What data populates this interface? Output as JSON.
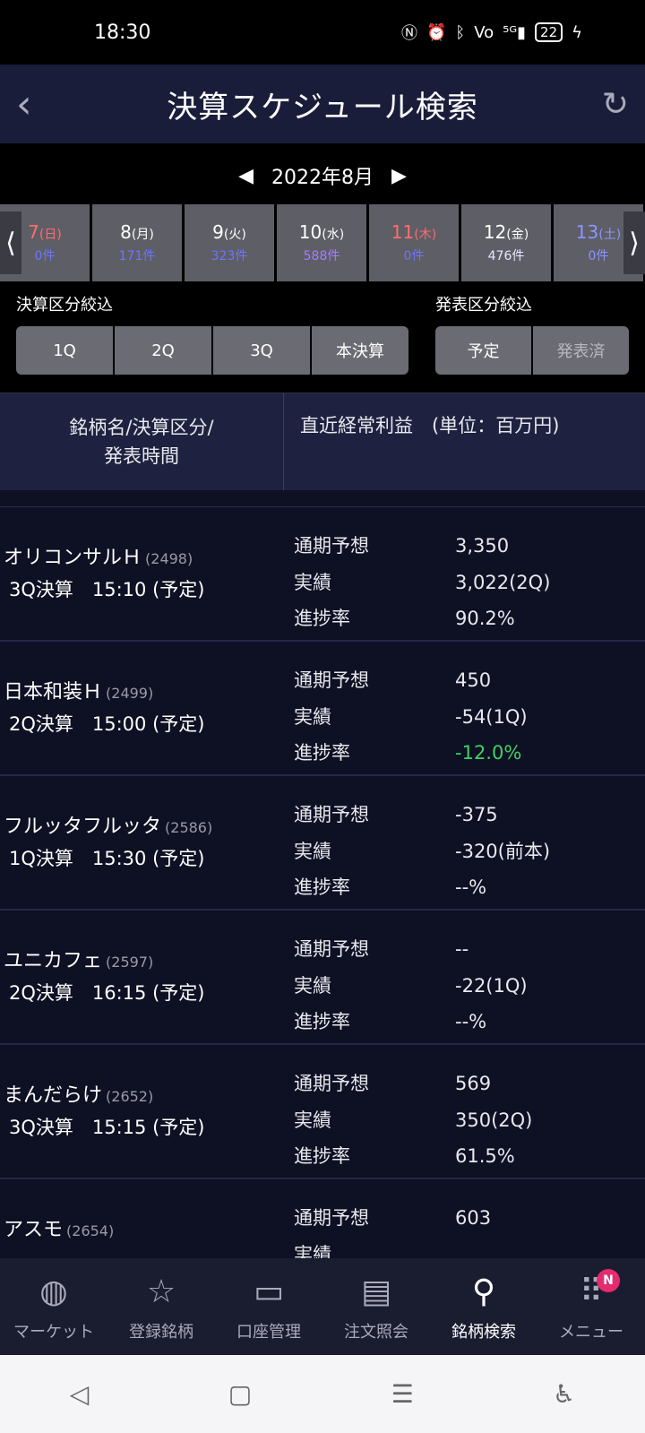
{
  "status": {
    "time": "18:30",
    "icons": [
      "nfc-icon",
      "alarm-icon",
      "bluetooth-icon",
      "volte-icon",
      "signal-5g-icon"
    ],
    "battery": "22"
  },
  "header": {
    "title": "決算スケジュール検索"
  },
  "month": {
    "label": "2022年8月"
  },
  "days": [
    {
      "date": "7",
      "dow": "(日)",
      "count": "0件",
      "type": "sun"
    },
    {
      "date": "8",
      "dow": "(月)",
      "count": "171件",
      "type": "weekday"
    },
    {
      "date": "9",
      "dow": "(火)",
      "count": "323件",
      "type": "weekday"
    },
    {
      "date": "10",
      "dow": "(水)",
      "count": "588件",
      "type": "weekday"
    },
    {
      "date": "11",
      "dow": "(木)",
      "count": "0件",
      "type": "holiday"
    },
    {
      "date": "12",
      "dow": "(金)",
      "count": "476件",
      "type": "selected"
    },
    {
      "date": "13",
      "dow": "(土)",
      "count": "0件",
      "type": "sat"
    }
  ],
  "filters": {
    "settlement_label": "決算区分絞込",
    "settlement_options": [
      "1Q",
      "2Q",
      "3Q",
      "本決算"
    ],
    "announce_label": "発表区分絞込",
    "announce_options": [
      "予定",
      "発表済"
    ]
  },
  "table_header": {
    "col1_line1": "銘柄名/決算区分/",
    "col1_line2": "発表時間",
    "col2": "直近経常利益　(単位：百万円)"
  },
  "row_labels": {
    "forecast": "通期予想",
    "actual": "実績",
    "progress": "進捗率"
  },
  "rows": [
    {
      "name": "オリコンサルＨ",
      "code": "(2498)",
      "sub": "3Q決算　15:10 (予定)",
      "forecast": "3,350",
      "actual": "3,022(2Q)",
      "progress": "90.2%"
    },
    {
      "name": "日本和装Ｈ",
      "code": "(2499)",
      "sub": "2Q決算　15:00 (予定)",
      "forecast": "450",
      "actual": "-54(1Q)",
      "progress": "-12.0%"
    },
    {
      "name": "フルッタフルッタ",
      "code": "(2586)",
      "sub": "1Q決算　15:30 (予定)",
      "forecast": "-375",
      "actual": "-320(前本)",
      "progress": "--%"
    },
    {
      "name": "ユニカフェ",
      "code": "(2597)",
      "sub": "2Q決算　16:15 (予定)",
      "forecast": "--",
      "actual": "-22(1Q)",
      "progress": "--%"
    },
    {
      "name": "まんだらけ",
      "code": "(2652)",
      "sub": "3Q決算　15:15 (予定)",
      "forecast": "569",
      "actual": "350(2Q)",
      "progress": "61.5%"
    },
    {
      "name": "アスモ",
      "code": "(2654)",
      "sub": "",
      "forecast": "603",
      "actual": "",
      "progress": ""
    }
  ],
  "bottom_nav": [
    {
      "label": "マーケット",
      "icon": "globe-icon"
    },
    {
      "label": "登録銘柄",
      "icon": "star-icon"
    },
    {
      "label": "口座管理",
      "icon": "card-icon"
    },
    {
      "label": "注文照会",
      "icon": "document-icon"
    },
    {
      "label": "銘柄検索",
      "icon": "search-icon"
    },
    {
      "label": "メニュー",
      "icon": "menu-grid-icon",
      "badge": "N"
    }
  ],
  "colors": {
    "selected_day": "#6c7cff",
    "negative_progress": "#3fd163",
    "badge": "#e52a6f"
  }
}
